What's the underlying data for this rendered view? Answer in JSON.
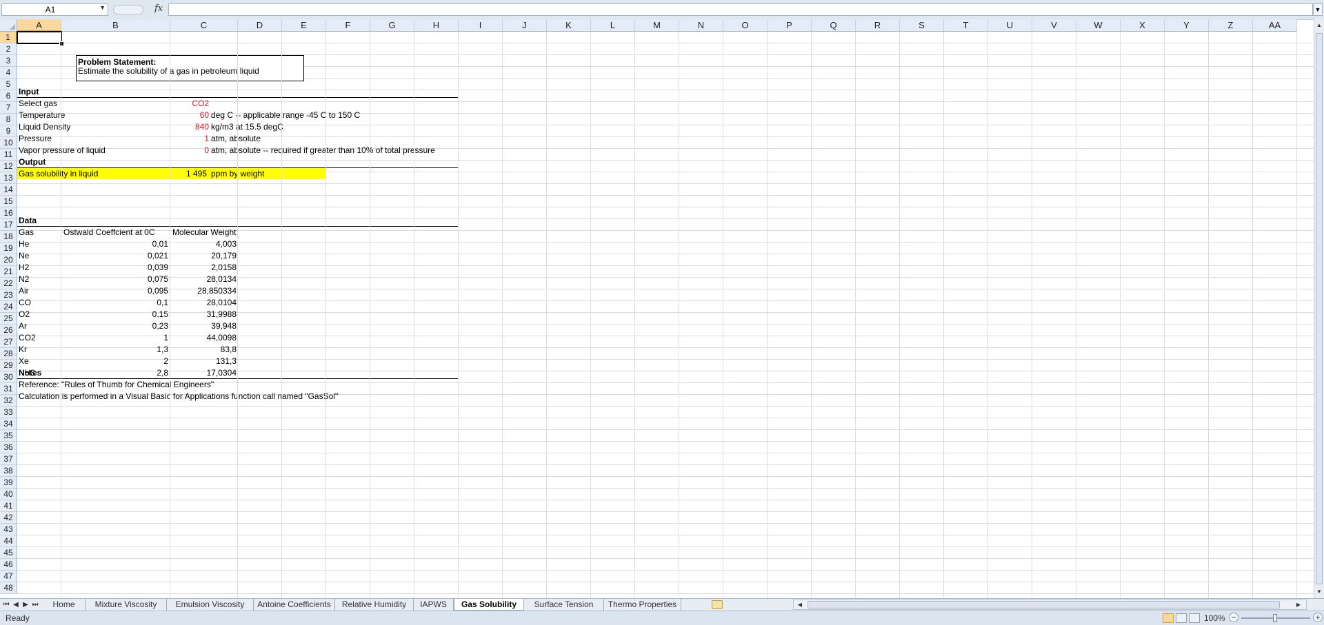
{
  "formula_bar": {
    "name_box": "A1",
    "fx_label": "fx",
    "formula": ""
  },
  "columns": [
    "A",
    "B",
    "C",
    "D",
    "E",
    "F",
    "G",
    "H",
    "I",
    "J",
    "K",
    "L",
    "M",
    "N",
    "O",
    "P",
    "Q",
    "R",
    "S",
    "T",
    "U",
    "V",
    "W",
    "X",
    "Y",
    "Z",
    "AA"
  ],
  "rows": [
    "1",
    "2",
    "3",
    "4",
    "5",
    "6",
    "7",
    "8",
    "9",
    "10",
    "11",
    "12",
    "13",
    "14",
    "15",
    "16",
    "17",
    "18",
    "19",
    "20",
    "21",
    "22",
    "23",
    "24",
    "25",
    "26",
    "27",
    "28",
    "29",
    "30",
    "31",
    "32",
    "33",
    "34",
    "35",
    "36",
    "37",
    "38",
    "39",
    "40",
    "41",
    "42",
    "43",
    "44",
    "45",
    "46",
    "47",
    "48"
  ],
  "sheet": {
    "problem_title": "Problem Statement:",
    "problem_text": "Estimate the solubility of a gas in petroleum liquid",
    "input_header": "Input",
    "inputs": [
      {
        "label": "Select gas",
        "value": "CO2",
        "unit": ""
      },
      {
        "label": "Temperature",
        "value": "60",
        "unit": "deg C -- applicable range -45 C to 150 C"
      },
      {
        "label": "Liquid Density",
        "value": "840",
        "unit": "kg/m3 at 15.5 degC"
      },
      {
        "label": "Pressure",
        "value": "1",
        "unit": "atm, absolute"
      },
      {
        "label": "Vapor pressure of liquid",
        "value": "0",
        "unit": "atm, absolute -- required if greater than 10% of total pressure"
      }
    ],
    "output_header": "Output",
    "output": {
      "label": "Gas solubility in liquid",
      "value": "1 495",
      "unit": "ppm by weight"
    },
    "data_header": "Data",
    "data_columns": [
      "Gas",
      "Ostwald Coeffcient at 0C",
      "Molecular Weight"
    ],
    "data_rows": [
      {
        "gas": "He",
        "ostwald": "0,01",
        "mw": "4,003"
      },
      {
        "gas": "Ne",
        "ostwald": "0,021",
        "mw": "20,179"
      },
      {
        "gas": "H2",
        "ostwald": "0,039",
        "mw": "2,0158"
      },
      {
        "gas": "N2",
        "ostwald": "0,075",
        "mw": "28,0134"
      },
      {
        "gas": "Air",
        "ostwald": "0,095",
        "mw": "28,850334"
      },
      {
        "gas": "CO",
        "ostwald": "0,1",
        "mw": "28,0104"
      },
      {
        "gas": "O2",
        "ostwald": "0,15",
        "mw": "31,9988"
      },
      {
        "gas": "Ar",
        "ostwald": "0,23",
        "mw": "39,948"
      },
      {
        "gas": "CO2",
        "ostwald": "1",
        "mw": "44,0098"
      },
      {
        "gas": "Kr",
        "ostwald": "1,3",
        "mw": "83,8"
      },
      {
        "gas": "Xe",
        "ostwald": "2",
        "mw": "131,3"
      },
      {
        "gas": "NH3",
        "ostwald": "2,8",
        "mw": "17,0304"
      }
    ],
    "notes_header": "Notes",
    "notes": [
      "Reference: \"Rules of Thumb for Chemical Engineers\"",
      "Calculation is performed in a Visual Basic for Applications function call named \"GasSol\""
    ]
  },
  "tabs": [
    {
      "label": "Home",
      "active": false
    },
    {
      "label": "Mixture Viscosity",
      "active": false
    },
    {
      "label": "Emulsion Viscosity",
      "active": false
    },
    {
      "label": "Antoine Coefficients",
      "active": false
    },
    {
      "label": "Relative Humidity",
      "active": false
    },
    {
      "label": "IAPWS",
      "active": false
    },
    {
      "label": "Gas Solubility",
      "active": true
    },
    {
      "label": "Surface Tension",
      "active": false
    },
    {
      "label": "Thermo Properties",
      "active": false
    }
  ],
  "status": {
    "text": "Ready",
    "zoom": "100%",
    "zoom_minus": "−",
    "zoom_plus": "+"
  },
  "colors": {
    "accent_red": "#e0161d",
    "highlight_yellow": "#ffff00",
    "header_bg": "#e4ecf7"
  },
  "icons": {
    "fx": "function-icon",
    "new_sheet": "insert-sheet-icon"
  }
}
